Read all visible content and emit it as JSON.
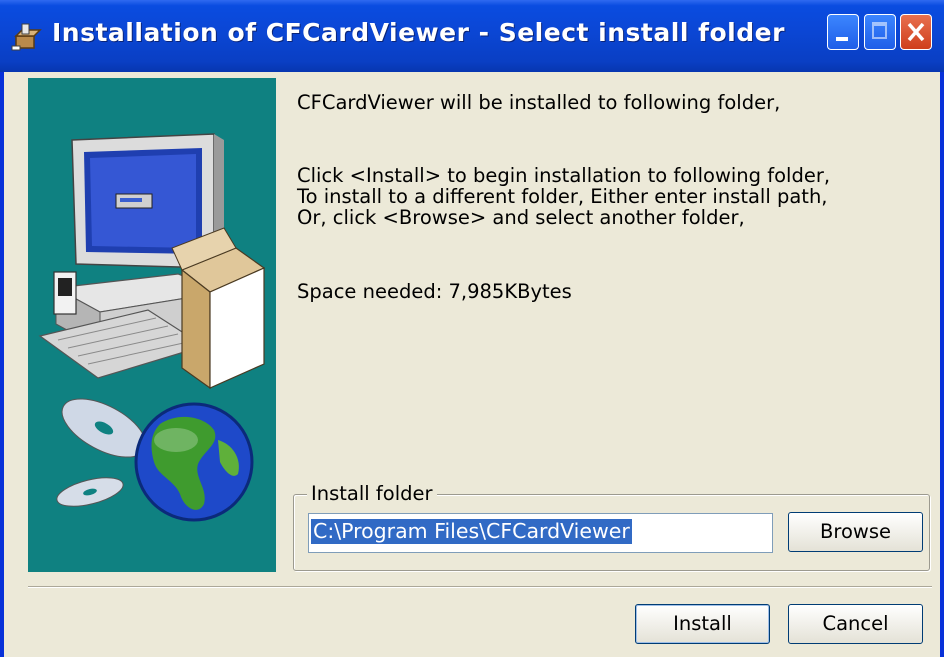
{
  "window": {
    "title": "Installation of CFCardViewer - Select install folder",
    "title_icon": "installer-package-icon",
    "controls": {
      "minimize": "minimize-icon",
      "maximize": "maximize-icon",
      "close": "close-icon"
    }
  },
  "message": {
    "line1": "CFCardViewer will be installed to following folder,",
    "line2": "Click <Install> to begin installation to following folder,",
    "line3": "To install to a different folder, Either enter install path,",
    "line4": "Or, click <Browse> and select another folder,",
    "space_needed": "Space needed: 7,985KBytes"
  },
  "install_folder": {
    "legend": "Install folder",
    "path": "C:\\Program Files\\CFCardViewer",
    "browse_label": "Browse"
  },
  "footer": {
    "install_label": "Install",
    "cancel_label": "Cancel"
  },
  "colors": {
    "title_bar": "#0a4ce0",
    "dialog_bg": "#ece9d8",
    "art_panel_bg": "#0f8181",
    "selection": "#316ac5"
  }
}
